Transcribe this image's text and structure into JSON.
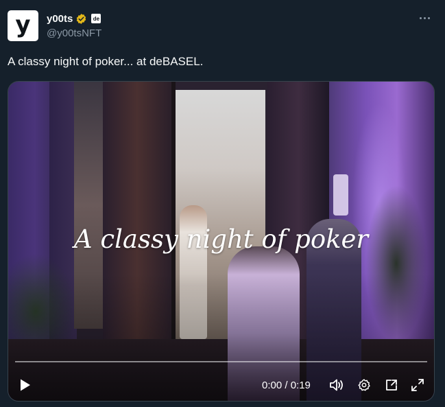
{
  "tweet": {
    "avatar_letter": "y",
    "display_name": "y00ts",
    "affiliate_badge": "de",
    "handle": "@y00tsNFT",
    "text": "A classy night of poker... at deBASEL."
  },
  "video": {
    "overlay_title": "A classy night of poker",
    "time": "0:00 / 0:19",
    "progress": 0
  },
  "icons": {
    "verified": "verified-badge-icon",
    "more": "more-icon",
    "play": "play-icon",
    "volume": "volume-icon",
    "settings": "gear-icon",
    "popout": "popout-icon",
    "fullscreen": "fullscreen-icon"
  },
  "colors": {
    "background": "#15202b",
    "text": "#f7f9f9",
    "secondary": "#8b98a5",
    "verified_gold": "#e2b719"
  }
}
